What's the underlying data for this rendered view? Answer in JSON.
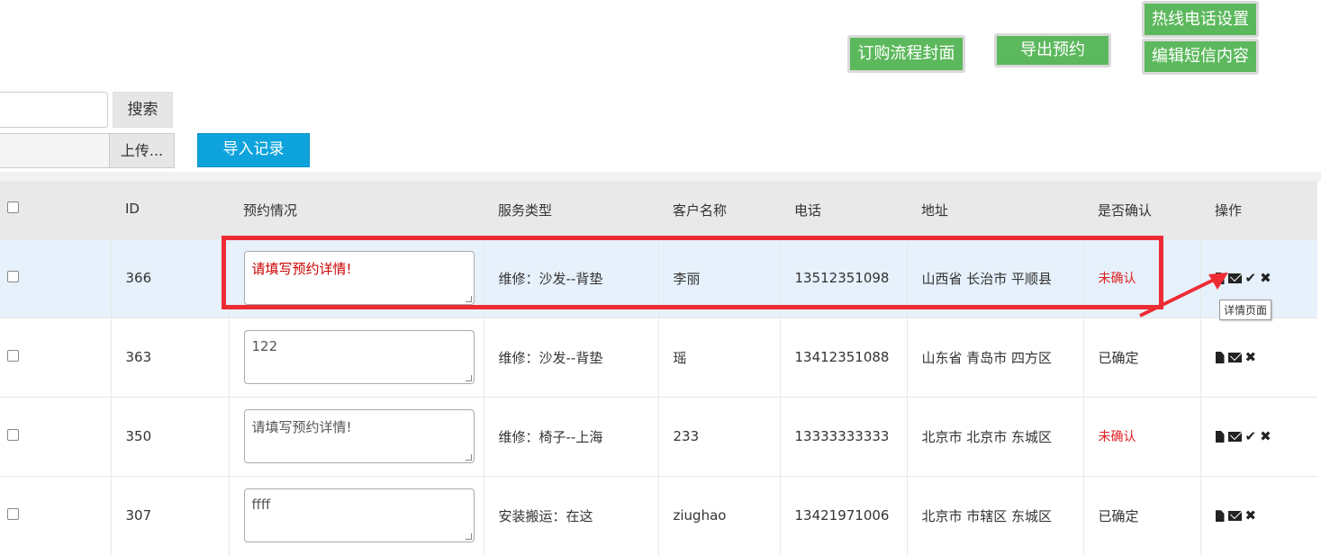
{
  "toolbar": {
    "flow_cover_label": "订购流程封面",
    "export_label": "导出预约",
    "hotline_label": "热线电话设置",
    "sms_label": "编辑短信内容"
  },
  "search": {
    "button_label": "搜索",
    "value": ""
  },
  "upload": {
    "button_label": "上传...",
    "import_label": "导入记录"
  },
  "table": {
    "headers": [
      "",
      "ID",
      "预约情况",
      "服务类型",
      "客户名称",
      "电话",
      "地址",
      "是否确认",
      "操作"
    ],
    "rows": [
      {
        "id": "366",
        "note": "请填写预约详情!",
        "service": "维修：沙发--背垫",
        "customer": "李丽",
        "phone": "13512351098",
        "address": "山西省 长治市 平顺县",
        "status": "未确认"
      },
      {
        "id": "363",
        "note": "122",
        "service": "维修：沙发--背垫",
        "customer": "瑶",
        "phone": "13412351088",
        "address": "山东省 青岛市 四方区",
        "status": "已确定"
      },
      {
        "id": "350",
        "note": "请填写预约详情!",
        "service": "维修：椅子--上海",
        "customer": "233",
        "phone": "13333333333",
        "address": "北京市 北京市 东城区",
        "status": "未确认"
      },
      {
        "id": "307",
        "note": "ffff",
        "service": "安装搬运：在这",
        "customer": "ziughao",
        "phone": "13421971006",
        "address": "北京市 市辖区 东城区",
        "status": "已确定"
      }
    ]
  },
  "tooltip": {
    "text": "详情页面"
  },
  "colors": {
    "accent_green": "#5cb85c",
    "import_blue": "#0ea3dc",
    "highlight_red": "#ee2c34",
    "unconfirmed": "#e02020"
  }
}
